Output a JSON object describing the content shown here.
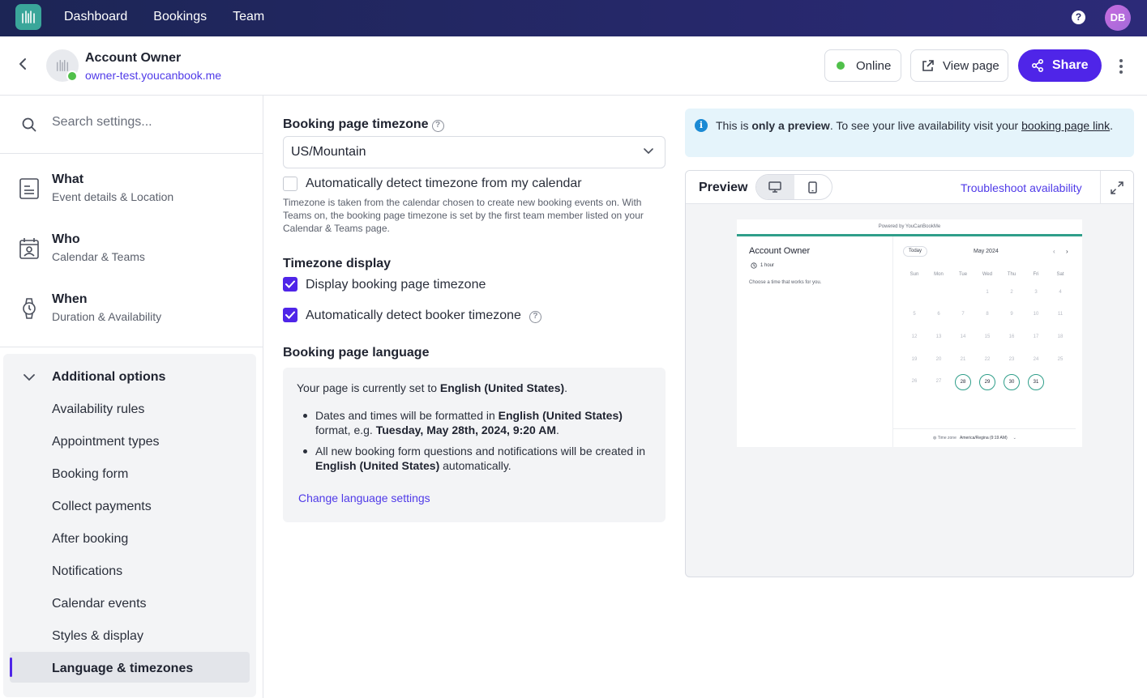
{
  "topnav": {
    "items": [
      "Dashboard",
      "Bookings",
      "Team"
    ],
    "user_initials": "DB"
  },
  "account": {
    "name": "Account Owner",
    "url": "owner-test.youcanbook.me"
  },
  "header_actions": {
    "status": "Online",
    "view_page": "View page",
    "share": "Share"
  },
  "sidebar": {
    "search_placeholder": "Search settings...",
    "sections": [
      {
        "title": "What",
        "subtitle": "Event details & Location"
      },
      {
        "title": "Who",
        "subtitle": "Calendar & Teams"
      },
      {
        "title": "When",
        "subtitle": "Duration & Availability"
      }
    ],
    "additional_title": "Additional options",
    "additional_items": [
      "Availability rules",
      "Appointment types",
      "Booking form",
      "Collect payments",
      "After booking",
      "Notifications",
      "Calendar events",
      "Styles & display",
      "Language & timezones"
    ],
    "active_item": "Language & timezones"
  },
  "form": {
    "timezone_label": "Booking page timezone",
    "timezone_value": "US/Mountain",
    "auto_detect_label": "Automatically detect timezone from my calendar",
    "auto_detect_checked": false,
    "help_text": "Timezone is taken from the calendar chosen to create new booking events on. With Teams on, the booking page timezone is set by the first team member listed on your Calendar & Teams page.",
    "display_title": "Timezone display",
    "display_tz_label": "Display booking page timezone",
    "display_tz_checked": true,
    "booker_tz_label": "Automatically detect booker timezone",
    "booker_tz_checked": true,
    "language_title": "Booking page language",
    "lang_intro": "Your page is currently set to",
    "lang_name": "English (United States)",
    "lang_bullet1_pre": "Dates and times will be formatted in",
    "lang_bullet1_mid": "format, e.g.",
    "lang_example": "Tuesday, May 28th, 2024, 9:20 AM",
    "lang_bullet2_pre": "All new booking form questions and notifications will be created in",
    "lang_bullet2_post": "automatically.",
    "change_language": "Change language settings"
  },
  "preview": {
    "info_pre": "This is",
    "info_bold": "only a preview",
    "info_mid": ". To see your live availability visit your",
    "info_link": "booking page link",
    "title": "Preview",
    "troubleshoot": "Troubleshoot availability",
    "mini": {
      "powered": "Powered by YouCanBookMe",
      "account": "Account Owner",
      "duration": "1 hour",
      "choose": "Choose a time that works for you.",
      "today": "Today",
      "month": "May 2024",
      "dow": [
        "Sun",
        "Mon",
        "Tue",
        "Wed",
        "Thu",
        "Fri",
        "Sat"
      ],
      "timezone_label": "Time zone",
      "timezone_value": "America/Regina (9:19 AM)",
      "available_days": [
        "28",
        "29",
        "30",
        "31"
      ]
    }
  }
}
